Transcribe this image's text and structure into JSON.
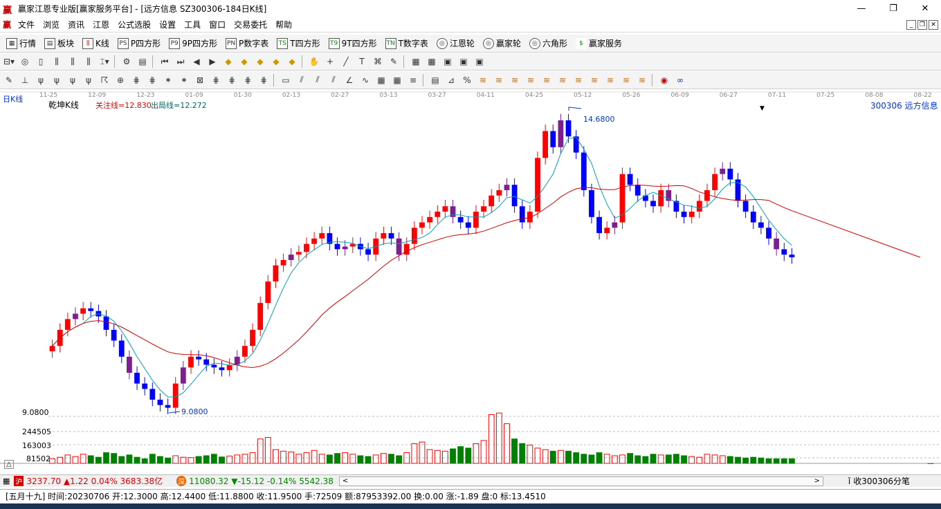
{
  "window": {
    "title": "赢家江恩专业版[赢家服务平台] - [远方信息  SZ300306-184日K线]",
    "logo": "赢",
    "min": "—",
    "max": "❐",
    "close": "✕"
  },
  "menu": {
    "logo": "赢",
    "items": [
      "文件",
      "浏览",
      "资讯",
      "江恩",
      "公式选股",
      "设置",
      "工具",
      "窗口",
      "交易委托",
      "帮助"
    ]
  },
  "toolbar1": {
    "items": [
      {
        "icon": "▦",
        "label": "行情"
      },
      {
        "icon": "▤",
        "label": "板块"
      },
      {
        "icon": "⫼",
        "label": "K线"
      },
      {
        "icon": "PS",
        "label": "P四方形"
      },
      {
        "icon": "P9",
        "label": "9P四方形"
      },
      {
        "icon": "PN",
        "label": "P数字表"
      },
      {
        "icon": "TS",
        "label": "T四方形"
      },
      {
        "icon": "T9",
        "label": "9T四方形"
      },
      {
        "icon": "TN",
        "label": "T数字表"
      },
      {
        "icon": "◎",
        "label": "江恩轮"
      },
      {
        "icon": "◎",
        "label": "赢家轮"
      },
      {
        "icon": "◎",
        "label": "六角形"
      },
      {
        "icon": "$",
        "label": "赢家服务"
      }
    ]
  },
  "chart": {
    "period_label": "日K线",
    "name_label": "乾坤K线",
    "focus_line": "关注线=12.830",
    "exit_line": "出局线=12.272",
    "stock_label": "300306  远方信息",
    "high_label": "14.6800",
    "low_label": "9.0800",
    "axis_low": "9.0800",
    "dates": [
      "11-25",
      "12-09",
      "12-23",
      "01-09",
      "01-30",
      "02-13",
      "02-27",
      "03-13",
      "03-27",
      "04-11",
      "04-25",
      "05-12",
      "05-26",
      "06-09",
      "06-27",
      "07-11",
      "07-25",
      "08-08",
      "08-22"
    ],
    "vol_ticks": [
      "244505",
      "163003",
      "81502"
    ],
    "colors": {
      "up": "#ff0000",
      "down": "#0000ff",
      "purple": "#7f1f8f",
      "ma_short": "#00a0c0",
      "ma_long": "#cc0000",
      "vol": "#008000"
    }
  },
  "chart_data": {
    "type": "candlestick",
    "title": "乾坤K线",
    "ylim": [
      9.08,
      14.68
    ],
    "high": 14.68,
    "low": 9.08,
    "closes": [
      10.3,
      10.6,
      10.8,
      10.9,
      11.0,
      10.95,
      10.85,
      10.6,
      10.4,
      10.1,
      9.8,
      9.6,
      9.5,
      9.3,
      9.2,
      9.15,
      9.6,
      9.9,
      10.1,
      10.05,
      9.95,
      9.9,
      9.85,
      9.95,
      10.1,
      10.3,
      10.6,
      11.1,
      11.5,
      11.8,
      11.9,
      12.0,
      12.05,
      12.2,
      12.3,
      12.4,
      12.2,
      12.1,
      12.15,
      12.2,
      12.1,
      12.0,
      12.3,
      12.4,
      12.3,
      12.0,
      12.2,
      12.5,
      12.6,
      12.7,
      12.8,
      12.9,
      12.7,
      12.6,
      12.5,
      12.8,
      12.9,
      13.1,
      13.2,
      13.3,
      12.9,
      12.6,
      12.8,
      13.8,
      14.3,
      14.0,
      14.5,
      14.2,
      13.9,
      13.2,
      12.7,
      12.4,
      12.5,
      12.6,
      13.5,
      13.3,
      13.1,
      13.0,
      12.9,
      13.2,
      13.0,
      12.8,
      12.7,
      12.8,
      13.0,
      13.2,
      13.5,
      13.6,
      13.4,
      13.0,
      12.8,
      12.6,
      12.5,
      12.3,
      12.1,
      12.0,
      11.95
    ],
    "volumes": [
      30,
      40,
      55,
      45,
      60,
      50,
      40,
      70,
      65,
      45,
      55,
      40,
      30,
      60,
      45,
      35,
      50,
      40,
      38,
      45,
      50,
      60,
      42,
      48,
      55,
      60,
      70,
      160,
      170,
      90,
      80,
      75,
      60,
      70,
      85,
      60,
      55,
      65,
      70,
      60,
      50,
      45,
      55,
      65,
      60,
      50,
      70,
      130,
      140,
      90,
      85,
      80,
      95,
      110,
      100,
      130,
      150,
      320,
      330,
      260,
      160,
      130,
      120,
      100,
      90,
      80,
      85,
      80,
      70,
      60,
      55,
      70,
      60,
      50,
      55,
      65,
      50,
      45,
      60,
      55,
      55,
      60,
      50,
      45,
      40,
      60,
      55,
      50,
      45,
      40,
      35,
      40,
      35,
      30,
      30,
      30,
      30
    ]
  },
  "status1": {
    "sh_icon": "沪",
    "sh_text": "3237.70 ▲1.22 0.04% 3683.38亿",
    "sz_icon": "深",
    "sz_text": "11080.32 ▼-15.12 -0.14% 5542.38",
    "right_text": "收300306分笔"
  },
  "status2": {
    "text": "[五月十九] 时间:20230706 开:12.3000 高:12.4400 低:11.8800 收:11.9500 手:72509 额:87953392.00 换:0.00 涨:-1.89 盘:0 标:13.4510"
  }
}
